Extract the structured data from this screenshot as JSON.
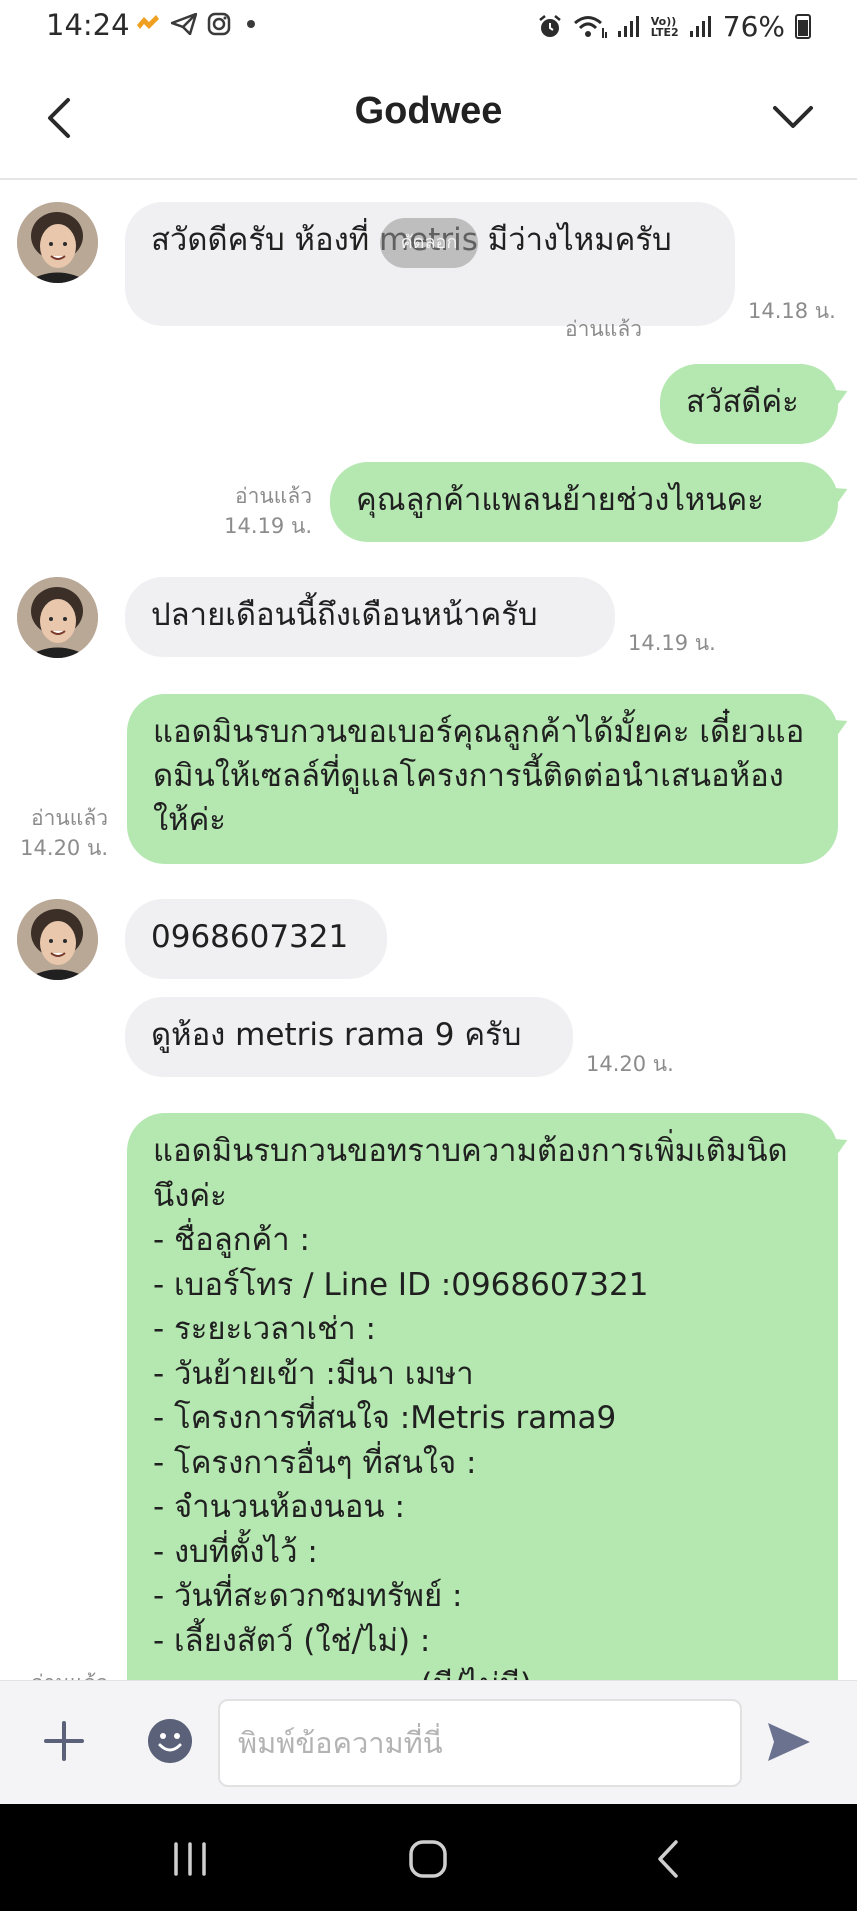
{
  "status_bar": {
    "time": "14:24",
    "battery": "76%",
    "left_icons": [
      "notification-icon",
      "telegram-icon",
      "instagram-icon",
      "dot-icon"
    ],
    "right_icons": [
      "alarm-icon",
      "wifi-icon",
      "signal-icon",
      "volte-icon",
      "signal-icon",
      "battery-icon"
    ],
    "volte_label": "Vo)) LTE2"
  },
  "header": {
    "title": "Godwee"
  },
  "copy_tooltip": "คัดลอก",
  "messages": {
    "m1": {
      "text": "สวัดดีครับ ห้องที่ metris มีว่างไหมครับ",
      "time": "14.18 น."
    },
    "m2": {
      "text": "สวัสดีค่ะ",
      "read": "อ่านแล้ว"
    },
    "m3": {
      "text": "คุณลูกค้าแพลนย้ายช่วงไหนคะ",
      "read": "อ่านแล้ว",
      "time": "14.19 น."
    },
    "m4": {
      "text": "ปลายเดือนนี้ถึงเดือนหน้าครับ",
      "time": "14.19 น."
    },
    "m5": {
      "text": "แอดมินรบกวนขอเบอร์คุณลูกค้าได้มั้ยคะ เดี๋ยวแอดมินให้เซลล์ที่ดูแลโครงการนี้ติดต่อนำเสนอห้องให้ค่ะ",
      "read": "อ่านแล้ว",
      "time": "14.20 น."
    },
    "m6": {
      "text": "0968607321"
    },
    "m7": {
      "text": "ดูห้อง metris rama 9 ครับ",
      "time": "14.20 น."
    },
    "m8": {
      "intro": "แอดมินรบกวนขอทราบความต้องการเพิ่มเติมนิดนึงค่ะ",
      "lines": [
        "- ชื่อลูกค้า :",
        "- เบอร์โทร / Line ID :0968607321",
        "- ระยะเวลาเช่า :",
        "- วันย้ายเข้า :มีนา เมษา",
        "- โครงการที่สนใจ :Metris rama9",
        "- โครงการอื่นๆ ที่สนใจ :",
        "- จำนวนห้องนอน :",
        "- งบที่ตั้งไว้ :",
        "- วันที่สะดวกชมทรัพย์ :",
        "- เลี้ยงสัตว์ (ใช่/ไม่) :",
        "- ........................ (มี/ไม่มี)"
      ],
      "read": "อ่านแล้ว"
    }
  },
  "input": {
    "placeholder": "พิมพ์ข้อความที่นี่"
  },
  "nav": {
    "buttons": [
      "recent-apps-icon",
      "home-icon",
      "back-icon"
    ]
  },
  "colors": {
    "outgoing": "#b5e8b1",
    "incoming": "#f0f0f2",
    "send": "#6b7290"
  }
}
